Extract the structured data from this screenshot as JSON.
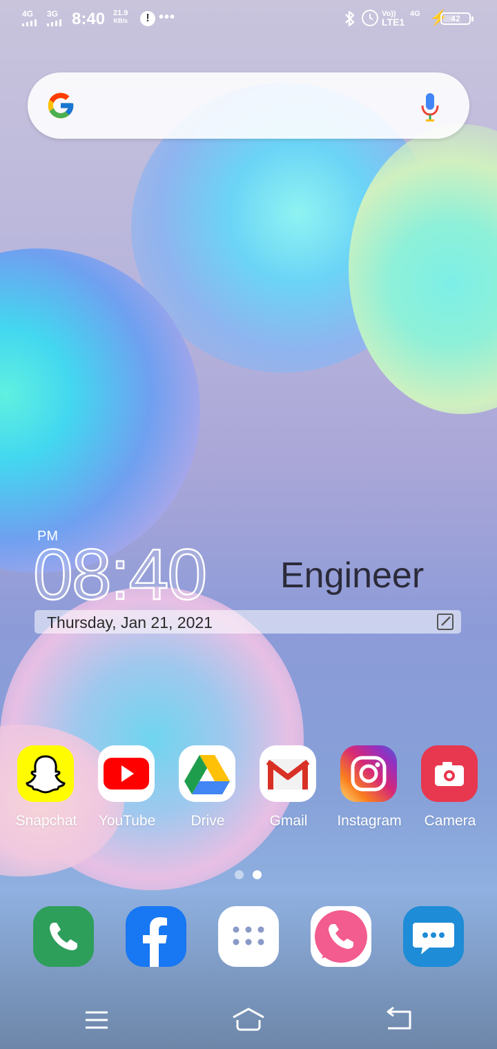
{
  "status_bar": {
    "sim1": "4G",
    "sim2": "3G",
    "time": "8:40",
    "speed_value": "21.9",
    "speed_unit": "KB/s",
    "alert": "!",
    "more": "•••",
    "bluetooth": "✱",
    "volte_top": "Vo))",
    "volte_bottom": "LTE1",
    "net": "4G",
    "charging": "⚡",
    "battery": "42"
  },
  "search": {
    "icon_left": "google-logo",
    "icon_right": "mic-icon"
  },
  "clock_widget": {
    "ampm": "PM",
    "time": "08:40",
    "weather_text": "Engineer",
    "date": "Thursday, Jan 21, 2021"
  },
  "apps": [
    {
      "label": "Snapchat",
      "icon": "snapchat-icon",
      "color": "#FFFC00"
    },
    {
      "label": "YouTube",
      "icon": "youtube-icon",
      "color": "#FF0000"
    },
    {
      "label": "Drive",
      "icon": "drive-icon",
      "color": "#FFFFFF"
    },
    {
      "label": "Gmail",
      "icon": "gmail-icon",
      "color": "#FFFFFF"
    },
    {
      "label": "Instagram",
      "icon": "instagram-icon",
      "color": "#D62976"
    },
    {
      "label": "Camera",
      "icon": "camera-icon",
      "color": "#E8384F"
    }
  ],
  "page_indicator": {
    "pages": 2,
    "current": 2
  },
  "dock": [
    {
      "icon": "phone-icon",
      "color": "#2E9E5B"
    },
    {
      "icon": "facebook-icon",
      "color": "#1877F2"
    },
    {
      "icon": "app-drawer-icon",
      "color": "#FFFFFF"
    },
    {
      "icon": "pink-phone-icon",
      "color": "#F25C8F"
    },
    {
      "icon": "messages-icon",
      "color": "#1E8CD6"
    }
  ],
  "navigation": [
    "menu-icon",
    "home-icon",
    "back-icon"
  ]
}
